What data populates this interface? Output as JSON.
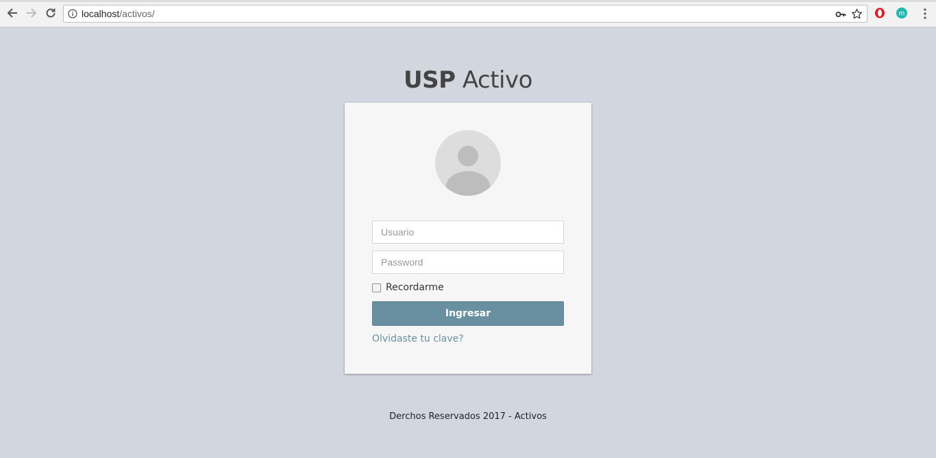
{
  "browser": {
    "url_host": "localhost",
    "url_path": "/activos/",
    "icons": [
      "back-arrow-icon",
      "forward-arrow-icon",
      "reload-icon",
      "info-icon",
      "key-icon",
      "star-icon",
      "opera-extension-icon",
      "m-extension-icon",
      "menu-dots-icon"
    ],
    "extension_letter": "m"
  },
  "header": {
    "brand": "USP",
    "title_rest": "Activo"
  },
  "login": {
    "username_placeholder": "Usuario",
    "password_placeholder": "Password",
    "remember_label": "Recordarme",
    "submit_label": "Ingresar",
    "forgot_link": "Olvidaste tu clave?"
  },
  "footer": {
    "text": "Derchos Reservados 2017 - Activos"
  },
  "colors": {
    "background": "#d2d6de",
    "card": "#f6f6f6",
    "button": "#6890a0",
    "link": "#6890a0"
  }
}
